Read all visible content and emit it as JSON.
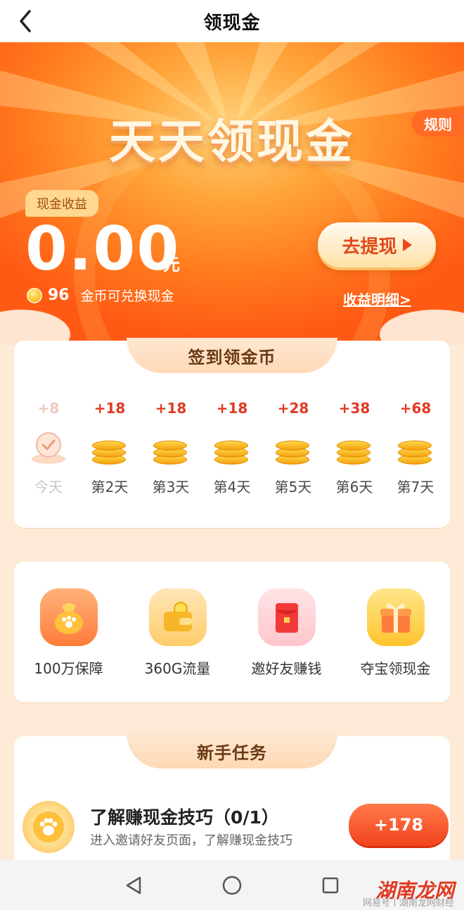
{
  "header": {
    "title": "领现金"
  },
  "hero": {
    "banner_title": "天天领现金",
    "rules_label": "规则",
    "earnings_label": "现金收益",
    "amount": "0.00",
    "unit": "元",
    "withdraw_label": "去提现",
    "coin_count": "96",
    "coin_text": "金币可兑换现金",
    "detail_link": "收益明细>"
  },
  "checkin": {
    "title": "签到领金币",
    "days": [
      {
        "reward": "+8",
        "label": "今天",
        "done": true
      },
      {
        "reward": "+18",
        "label": "第2天"
      },
      {
        "reward": "+18",
        "label": "第3天"
      },
      {
        "reward": "+18",
        "label": "第4天"
      },
      {
        "reward": "+28",
        "label": "第5天"
      },
      {
        "reward": "+38",
        "label": "第6天"
      },
      {
        "reward": "+68",
        "label": "第7天"
      }
    ]
  },
  "features": [
    {
      "label": "100万保障",
      "icon": "money-bag-icon"
    },
    {
      "label": "360G流量",
      "icon": "wallet-icon"
    },
    {
      "label": "邀好友赚钱",
      "icon": "red-envelope-icon"
    },
    {
      "label": "夺宝领现金",
      "icon": "gift-box-icon"
    }
  ],
  "tasks": {
    "title": "新手任务",
    "items": [
      {
        "title": "了解赚现金技巧（0/1）",
        "desc": "进入邀请好友页面，了解赚现金技巧",
        "reward": "+178",
        "icon": "paw-coin-icon"
      }
    ]
  },
  "watermark": {
    "main": "湖南龙网",
    "sub": "网易号丨湖南龙网财经"
  },
  "colors": {
    "accent": "#ff6a24",
    "reward_red": "#e03a22",
    "background": "#fdebd8"
  }
}
